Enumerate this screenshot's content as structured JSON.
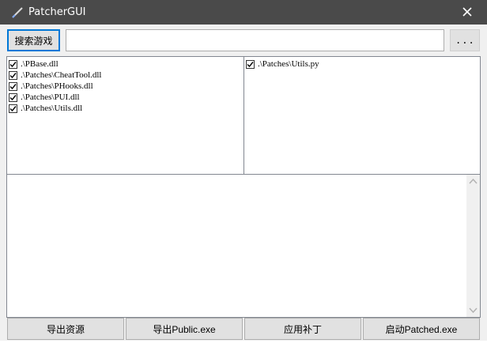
{
  "window": {
    "title": "PatcherGUI",
    "icons": {
      "app": "pen-icon",
      "close": "close-icon"
    }
  },
  "toolbar": {
    "search_label": "搜索游戏",
    "path_value": "",
    "browse_label": "..."
  },
  "left_list": {
    "items": [
      {
        "label": ".\\PBase.dll",
        "checked": true
      },
      {
        "label": ".\\Patches\\CheatTool.dll",
        "checked": true
      },
      {
        "label": ".\\Patches\\PHooks.dll",
        "checked": true
      },
      {
        "label": ".\\Patches\\PUI.dll",
        "checked": true
      },
      {
        "label": ".\\Patches\\Utils.dll",
        "checked": true
      }
    ]
  },
  "right_list": {
    "items": [
      {
        "label": ".\\Patches\\Utils.py",
        "checked": true
      }
    ]
  },
  "log": {
    "text": ""
  },
  "actions": {
    "export_resources": "导出资源",
    "export_public": "导出Public.exe",
    "apply_patch": "应用补丁",
    "launch_patched": "启动Patched.exe"
  },
  "colors": {
    "titlebar": "#4a4a4a",
    "focus": "#0078d7"
  }
}
